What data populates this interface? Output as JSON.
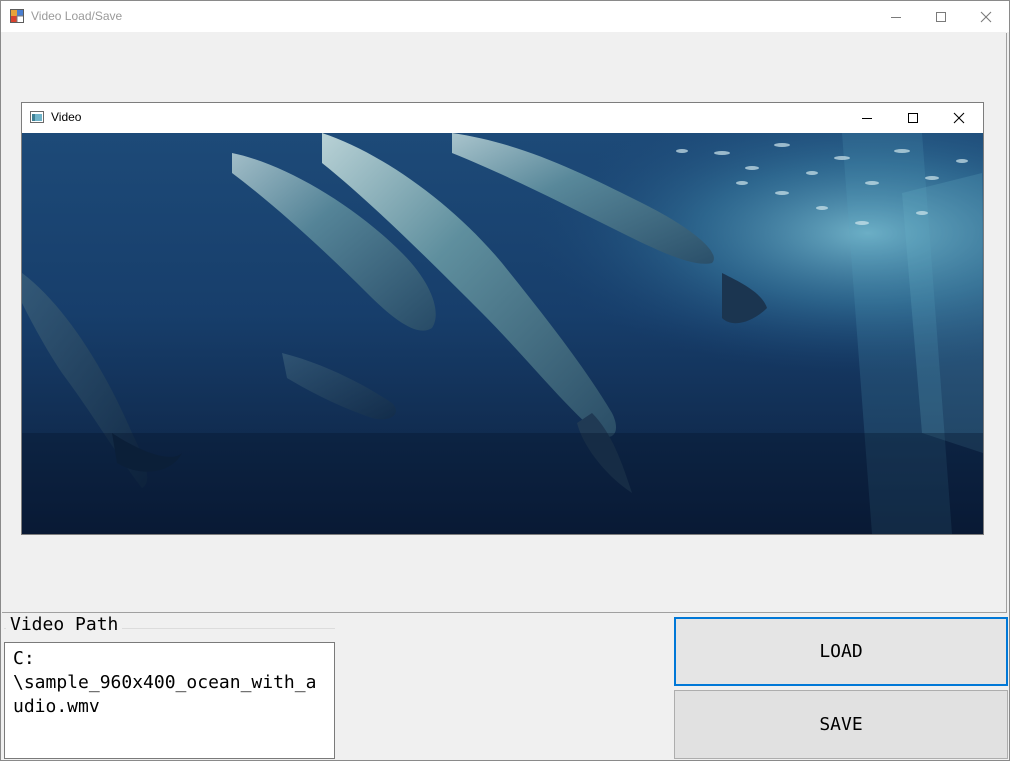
{
  "window": {
    "title": "Video Load/Save"
  },
  "video_window": {
    "title": "Video"
  },
  "video_path": {
    "label": "Video Path",
    "value": "C:\n\\sample_960x400_ocean_with_audio.wmv"
  },
  "buttons": {
    "load_label": "LOAD",
    "save_label": "SAVE"
  },
  "colors": {
    "focus_border": "#0078d7",
    "button_face": "#e1e1e1",
    "window_bg": "#f0f0f0"
  },
  "icons": {
    "app": "app-form-icon",
    "video": "video-window-icon",
    "minimize": "minimize-icon",
    "maximize": "maximize-icon",
    "close": "close-icon"
  }
}
